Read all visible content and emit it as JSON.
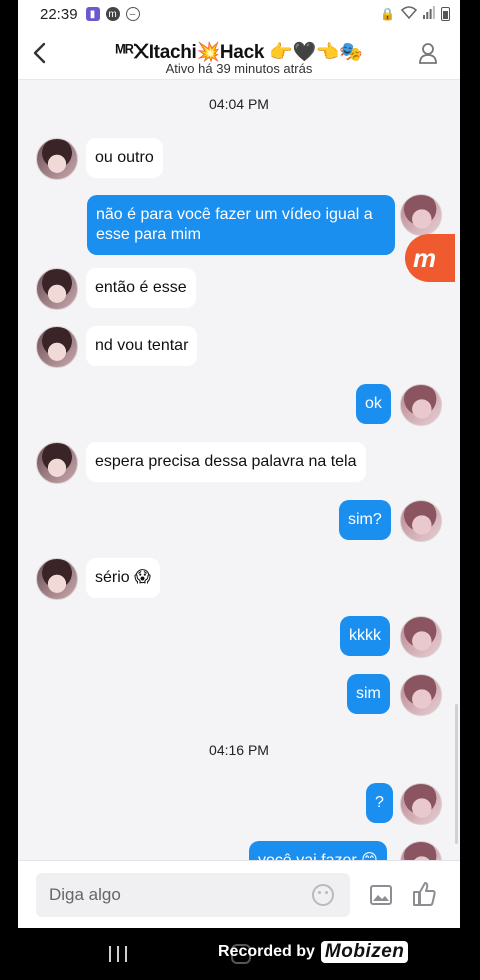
{
  "status_bar": {
    "time": "22:39",
    "left_icons": [
      "notification-icon",
      "mobizen-icon",
      "minus-circle-icon"
    ],
    "right_icons": [
      "lock-icon",
      "wifi-icon",
      "signal-icon",
      "battery-icon"
    ]
  },
  "header": {
    "title": "ᴹᴿ᙭Itachi💥Hack 👉🖤👈🎭",
    "subtitle": "Ativo há 39 minutos atrás"
  },
  "chat": {
    "timestamps": [
      "04:04 PM",
      "04:16 PM"
    ],
    "messages": [
      {
        "from": "them",
        "text": "ou outro"
      },
      {
        "from": "me",
        "text": "não é para você fazer um vídeo igual a esse para mim"
      },
      {
        "from": "them",
        "text": "então é esse"
      },
      {
        "from": "them",
        "text": "nd vou tentar"
      },
      {
        "from": "me",
        "text": "ok"
      },
      {
        "from": "them",
        "text": "espera precisa dessa palavra na tela"
      },
      {
        "from": "me",
        "text": "sim?"
      },
      {
        "from": "them",
        "text": "sério 😱"
      },
      {
        "from": "me",
        "text": "kkkk"
      },
      {
        "from": "me",
        "text": "sim"
      },
      {
        "from": "me",
        "text": "?"
      },
      {
        "from": "me",
        "text": "você vai fazer 😊"
      }
    ]
  },
  "floating_badge": {
    "letter": "m"
  },
  "composer": {
    "placeholder": "Diga algo",
    "icons": [
      "emoji-icon",
      "image-icon",
      "thumbs-up-icon"
    ]
  },
  "watermark": {
    "prefix": "Recorded by",
    "brand": "Mobizen"
  },
  "colors": {
    "outgoing_bubble": "#1a8ff0",
    "incoming_bubble": "#ffffff",
    "chat_background": "#f4f4f7",
    "floating_badge": "#ef5a2e"
  }
}
